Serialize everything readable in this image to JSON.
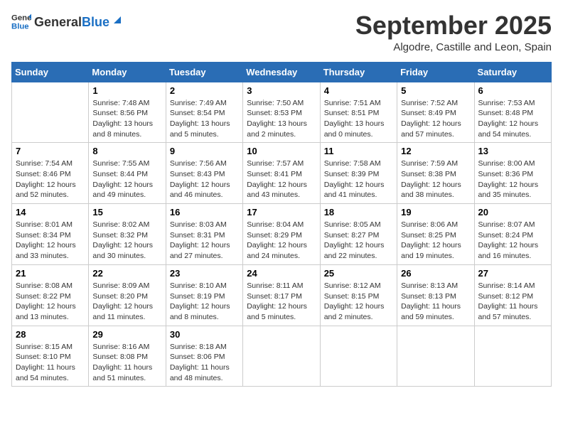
{
  "header": {
    "logo_general": "General",
    "logo_blue": "Blue",
    "month_title": "September 2025",
    "subtitle": "Algodre, Castille and Leon, Spain"
  },
  "weekdays": [
    "Sunday",
    "Monday",
    "Tuesday",
    "Wednesday",
    "Thursday",
    "Friday",
    "Saturday"
  ],
  "weeks": [
    [
      {
        "day": "",
        "sunrise": "",
        "sunset": "",
        "daylight": ""
      },
      {
        "day": "1",
        "sunrise": "Sunrise: 7:48 AM",
        "sunset": "Sunset: 8:56 PM",
        "daylight": "Daylight: 13 hours and 8 minutes."
      },
      {
        "day": "2",
        "sunrise": "Sunrise: 7:49 AM",
        "sunset": "Sunset: 8:54 PM",
        "daylight": "Daylight: 13 hours and 5 minutes."
      },
      {
        "day": "3",
        "sunrise": "Sunrise: 7:50 AM",
        "sunset": "Sunset: 8:53 PM",
        "daylight": "Daylight: 13 hours and 2 minutes."
      },
      {
        "day": "4",
        "sunrise": "Sunrise: 7:51 AM",
        "sunset": "Sunset: 8:51 PM",
        "daylight": "Daylight: 13 hours and 0 minutes."
      },
      {
        "day": "5",
        "sunrise": "Sunrise: 7:52 AM",
        "sunset": "Sunset: 8:49 PM",
        "daylight": "Daylight: 12 hours and 57 minutes."
      },
      {
        "day": "6",
        "sunrise": "Sunrise: 7:53 AM",
        "sunset": "Sunset: 8:48 PM",
        "daylight": "Daylight: 12 hours and 54 minutes."
      }
    ],
    [
      {
        "day": "7",
        "sunrise": "Sunrise: 7:54 AM",
        "sunset": "Sunset: 8:46 PM",
        "daylight": "Daylight: 12 hours and 52 minutes."
      },
      {
        "day": "8",
        "sunrise": "Sunrise: 7:55 AM",
        "sunset": "Sunset: 8:44 PM",
        "daylight": "Daylight: 12 hours and 49 minutes."
      },
      {
        "day": "9",
        "sunrise": "Sunrise: 7:56 AM",
        "sunset": "Sunset: 8:43 PM",
        "daylight": "Daylight: 12 hours and 46 minutes."
      },
      {
        "day": "10",
        "sunrise": "Sunrise: 7:57 AM",
        "sunset": "Sunset: 8:41 PM",
        "daylight": "Daylight: 12 hours and 43 minutes."
      },
      {
        "day": "11",
        "sunrise": "Sunrise: 7:58 AM",
        "sunset": "Sunset: 8:39 PM",
        "daylight": "Daylight: 12 hours and 41 minutes."
      },
      {
        "day": "12",
        "sunrise": "Sunrise: 7:59 AM",
        "sunset": "Sunset: 8:38 PM",
        "daylight": "Daylight: 12 hours and 38 minutes."
      },
      {
        "day": "13",
        "sunrise": "Sunrise: 8:00 AM",
        "sunset": "Sunset: 8:36 PM",
        "daylight": "Daylight: 12 hours and 35 minutes."
      }
    ],
    [
      {
        "day": "14",
        "sunrise": "Sunrise: 8:01 AM",
        "sunset": "Sunset: 8:34 PM",
        "daylight": "Daylight: 12 hours and 33 minutes."
      },
      {
        "day": "15",
        "sunrise": "Sunrise: 8:02 AM",
        "sunset": "Sunset: 8:32 PM",
        "daylight": "Daylight: 12 hours and 30 minutes."
      },
      {
        "day": "16",
        "sunrise": "Sunrise: 8:03 AM",
        "sunset": "Sunset: 8:31 PM",
        "daylight": "Daylight: 12 hours and 27 minutes."
      },
      {
        "day": "17",
        "sunrise": "Sunrise: 8:04 AM",
        "sunset": "Sunset: 8:29 PM",
        "daylight": "Daylight: 12 hours and 24 minutes."
      },
      {
        "day": "18",
        "sunrise": "Sunrise: 8:05 AM",
        "sunset": "Sunset: 8:27 PM",
        "daylight": "Daylight: 12 hours and 22 minutes."
      },
      {
        "day": "19",
        "sunrise": "Sunrise: 8:06 AM",
        "sunset": "Sunset: 8:25 PM",
        "daylight": "Daylight: 12 hours and 19 minutes."
      },
      {
        "day": "20",
        "sunrise": "Sunrise: 8:07 AM",
        "sunset": "Sunset: 8:24 PM",
        "daylight": "Daylight: 12 hours and 16 minutes."
      }
    ],
    [
      {
        "day": "21",
        "sunrise": "Sunrise: 8:08 AM",
        "sunset": "Sunset: 8:22 PM",
        "daylight": "Daylight: 12 hours and 13 minutes."
      },
      {
        "day": "22",
        "sunrise": "Sunrise: 8:09 AM",
        "sunset": "Sunset: 8:20 PM",
        "daylight": "Daylight: 12 hours and 11 minutes."
      },
      {
        "day": "23",
        "sunrise": "Sunrise: 8:10 AM",
        "sunset": "Sunset: 8:19 PM",
        "daylight": "Daylight: 12 hours and 8 minutes."
      },
      {
        "day": "24",
        "sunrise": "Sunrise: 8:11 AM",
        "sunset": "Sunset: 8:17 PM",
        "daylight": "Daylight: 12 hours and 5 minutes."
      },
      {
        "day": "25",
        "sunrise": "Sunrise: 8:12 AM",
        "sunset": "Sunset: 8:15 PM",
        "daylight": "Daylight: 12 hours and 2 minutes."
      },
      {
        "day": "26",
        "sunrise": "Sunrise: 8:13 AM",
        "sunset": "Sunset: 8:13 PM",
        "daylight": "Daylight: 11 hours and 59 minutes."
      },
      {
        "day": "27",
        "sunrise": "Sunrise: 8:14 AM",
        "sunset": "Sunset: 8:12 PM",
        "daylight": "Daylight: 11 hours and 57 minutes."
      }
    ],
    [
      {
        "day": "28",
        "sunrise": "Sunrise: 8:15 AM",
        "sunset": "Sunset: 8:10 PM",
        "daylight": "Daylight: 11 hours and 54 minutes."
      },
      {
        "day": "29",
        "sunrise": "Sunrise: 8:16 AM",
        "sunset": "Sunset: 8:08 PM",
        "daylight": "Daylight: 11 hours and 51 minutes."
      },
      {
        "day": "30",
        "sunrise": "Sunrise: 8:18 AM",
        "sunset": "Sunset: 8:06 PM",
        "daylight": "Daylight: 11 hours and 48 minutes."
      },
      {
        "day": "",
        "sunrise": "",
        "sunset": "",
        "daylight": ""
      },
      {
        "day": "",
        "sunrise": "",
        "sunset": "",
        "daylight": ""
      },
      {
        "day": "",
        "sunrise": "",
        "sunset": "",
        "daylight": ""
      },
      {
        "day": "",
        "sunrise": "",
        "sunset": "",
        "daylight": ""
      }
    ]
  ]
}
